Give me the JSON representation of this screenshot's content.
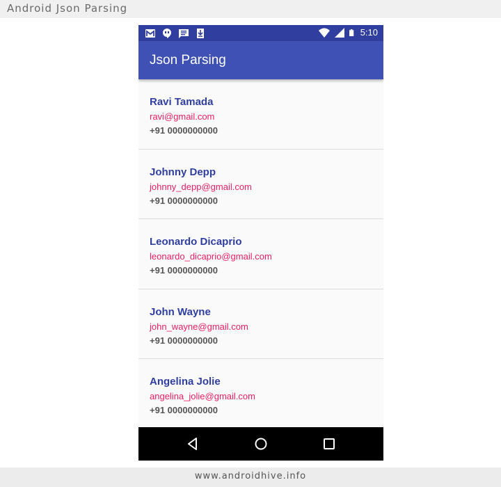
{
  "banner": {
    "title": "Android Json Parsing",
    "footer": "www.androidhive.info"
  },
  "status_bar": {
    "time": "5:10",
    "left_icons": [
      "gmail-icon",
      "hangouts-icon",
      "message-icon",
      "download-icon"
    ],
    "right_icons": [
      "wifi-icon",
      "signal-icon",
      "battery-icon"
    ]
  },
  "app_bar": {
    "title": "Json Parsing"
  },
  "contacts": [
    {
      "name": "Ravi Tamada",
      "email": "ravi@gmail.com",
      "phone": "+91 0000000000"
    },
    {
      "name": "Johnny Depp",
      "email": "johnny_depp@gmail.com",
      "phone": "+91 0000000000"
    },
    {
      "name": "Leonardo Dicaprio",
      "email": "leonardo_dicaprio@gmail.com",
      "phone": "+91 0000000000"
    },
    {
      "name": "John Wayne",
      "email": "john_wayne@gmail.com",
      "phone": "+91 0000000000"
    },
    {
      "name": "Angelina Jolie",
      "email": "angelina_jolie@gmail.com",
      "phone": "+91 0000000000"
    }
  ],
  "nav_bar": {
    "buttons": [
      "back-icon",
      "home-icon",
      "recents-icon"
    ]
  },
  "colors": {
    "status_bar": "#303f9f",
    "app_bar": "#3f51b5",
    "name": "#303f9f",
    "email": "#e91e63",
    "phone": "#555555"
  }
}
